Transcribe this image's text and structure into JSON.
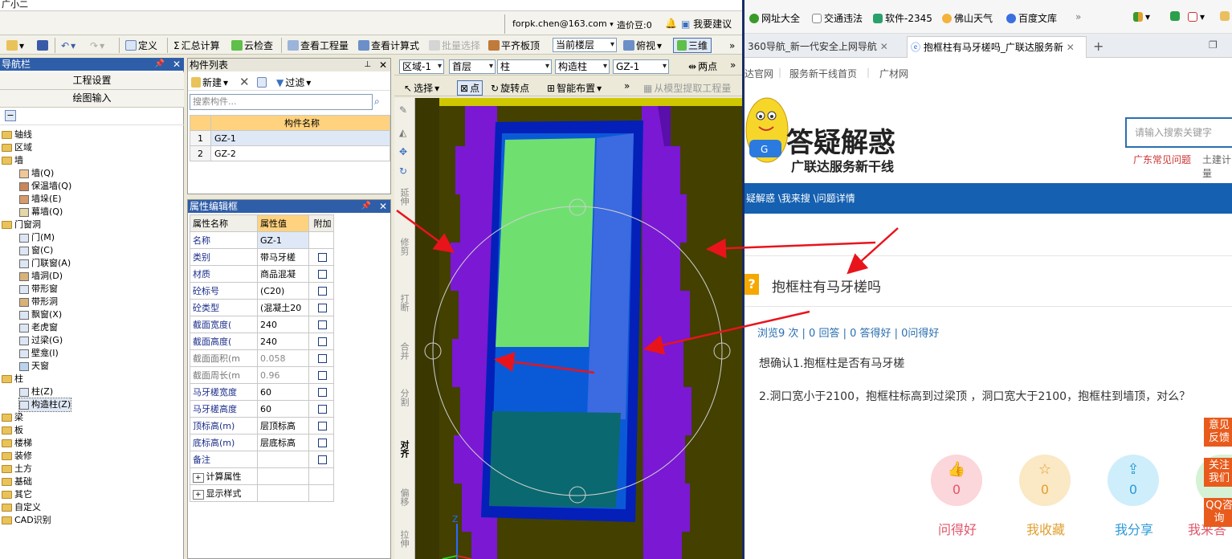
{
  "cad": {
    "title": "广小二",
    "account": {
      "email": "forpk.chen@163.com",
      "bean": "造价豆:0",
      "suggest": "我要建议"
    },
    "toolbar": [
      "定义",
      "汇总计算",
      "云检查",
      "查看工程量",
      "查看计算式",
      "批量选择",
      "平齐板顶"
    ],
    "floor_select": "当前楼层",
    "view_select": "俯视",
    "btn_3d": "三维",
    "nav": {
      "title": "导航栏",
      "btn1": "工程设置",
      "btn2": "绘图输入",
      "tree": [
        "轴线",
        "区域",
        "墙",
        "墙(Q)",
        "保温墙(Q)",
        "墙垛(E)",
        "幕墙(Q)",
        "门窗洞",
        "门(M)",
        "窗(C)",
        "门联窗(A)",
        "墙洞(D)",
        "带形窗",
        "带形洞",
        "飘窗(X)",
        "老虎窗",
        "过梁(G)",
        "壁龛(I)",
        "天窗",
        "柱",
        "柱(Z)",
        "构造柱(Z)",
        "梁",
        "板",
        "楼梯",
        "装修",
        "土方",
        "基础",
        "其它",
        "自定义",
        "CAD识别"
      ]
    },
    "comp": {
      "title": "构件列表",
      "new_btn": "新建",
      "filter_btn": "过滤",
      "search_placeholder": "搜索构件...",
      "col_name": "构件名称",
      "rows": [
        {
          "no": "1",
          "name": "GZ-1"
        },
        {
          "no": "2",
          "name": "GZ-2"
        }
      ]
    },
    "prop": {
      "title": "属性编辑框",
      "headers": [
        "属性名称",
        "属性值",
        "附加"
      ],
      "rows": [
        {
          "name": "名称",
          "value": "GZ-1"
        },
        {
          "name": "类别",
          "value": "带马牙槎"
        },
        {
          "name": "材质",
          "value": "商品混凝"
        },
        {
          "name": "砼标号",
          "value": "(C20)"
        },
        {
          "name": "砼类型",
          "value": "(混凝土20"
        },
        {
          "name": "截面宽度(",
          "value": "240"
        },
        {
          "name": "截面高度(",
          "value": "240"
        },
        {
          "name": "截面面积(m",
          "value": "0.058"
        },
        {
          "name": "截面周长(m",
          "value": "0.96"
        },
        {
          "name": "马牙槎宽度",
          "value": "60"
        },
        {
          "name": "马牙槎高度",
          "value": "60"
        },
        {
          "name": "顶标高(m)",
          "value": "层顶标高"
        },
        {
          "name": "底标高(m)",
          "value": "层底标高"
        },
        {
          "name": "备注",
          "value": ""
        }
      ],
      "calc": "计算属性",
      "display": "显示样式"
    },
    "view": {
      "selects": [
        "区域-1",
        "首层",
        "柱",
        "构造柱",
        "GZ-1"
      ],
      "two_point": "两点",
      "select_btn": "选择",
      "point_btn": "点",
      "rotate_btn": "旋转点",
      "smart_btn": "智能布置",
      "extract_btn": "从模型提取工程量",
      "side": [
        "延伸",
        "修剪",
        "打断",
        "合并",
        "分割",
        "对齐",
        "偏移",
        "拉伸"
      ]
    }
  },
  "browser": {
    "bookmarks": [
      "网址大全",
      "交通违法",
      "软件-2345",
      "佛山天气",
      "百度文库"
    ],
    "tabs": [
      "360导航_新一代安全上网导航",
      "抱框柱有马牙槎吗_广联达服务新"
    ],
    "links": [
      "达官网",
      "服务新干线首页",
      "广材网"
    ],
    "logo_title": "答疑解惑",
    "logo_sub": "广联达服务新干线",
    "search_placeholder": "请输入搜索关键字",
    "hot": [
      "广东常见问题",
      "土建计量"
    ],
    "breadcrumb": "疑解惑 \\我来搜 \\问题详情",
    "question": "抱框柱有马牙槎吗",
    "stats": "浏览9 次 | 0 回答 | 0 答得好 | 0问得好",
    "body1": "想确认1.抱框柱是否有马牙槎",
    "body2": "2.洞口宽小于2100，抱框柱标高到过梁顶 ，洞口宽大于2100，抱框柱到墙顶，对么？",
    "actions": [
      {
        "label": "问得好",
        "count": "0"
      },
      {
        "label": "我收藏",
        "count": "0"
      },
      {
        "label": "我分享",
        "count": "0"
      },
      {
        "label": "我来答",
        "count": ""
      }
    ],
    "side_buttons": [
      "意见反馈",
      "关注我们",
      "QQ咨询"
    ],
    "colors": {
      "accent": "#1560b0",
      "orange": "#e85b1c"
    }
  }
}
